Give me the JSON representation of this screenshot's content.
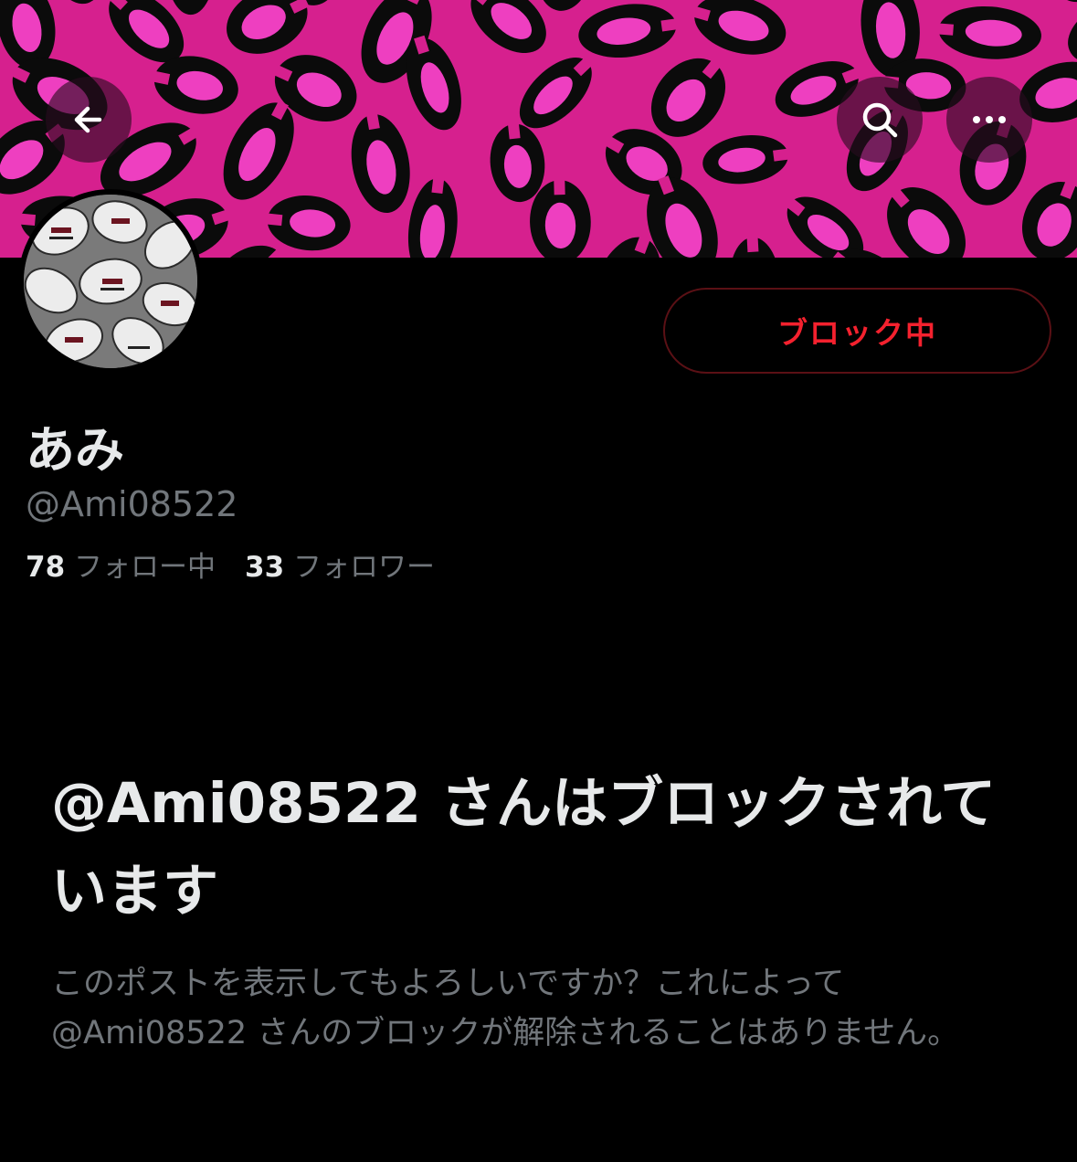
{
  "header": {
    "back_icon": "arrow-left-icon",
    "search_icon": "search-icon",
    "more_icon": "more-horizontal-icon"
  },
  "banner": {
    "pattern": "pink-leopard-print",
    "colors": {
      "base": "#d6208e",
      "spot": "#0b0b0b",
      "inner": "#ee3fc0"
    }
  },
  "profile": {
    "display_name": "あみ",
    "handle": "@Ami08522",
    "block_button_label": "ブロック中",
    "following_count": "78",
    "following_label": "フォロー中",
    "followers_count": "33",
    "followers_label": "フォロワー"
  },
  "blocked_notice": {
    "title": "@Ami08522 さんはブロックされています",
    "description": "このポストを表示してもよろしいですか？これによって @Ami08522 さんのブロックが解除されることはありません。"
  },
  "colors": {
    "background": "#000000",
    "primary_text": "#e7e9ea",
    "secondary_text": "#71767b",
    "block_red": "#f4212e",
    "block_border": "#5b1015"
  }
}
